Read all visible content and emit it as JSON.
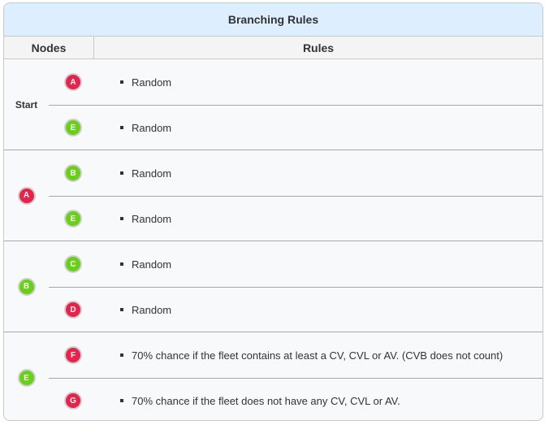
{
  "title": "Branching Rules",
  "headers": {
    "nodes": "Nodes",
    "rules": "Rules"
  },
  "colors": {
    "red_node": "#e8224a",
    "green_node": "#66d116",
    "title_bg": "#ddeeff"
  },
  "groups": [
    {
      "source": "Start",
      "source_type": "text",
      "branches": [
        {
          "node": "A",
          "color": "red",
          "rule": "Random"
        },
        {
          "node": "E",
          "color": "green",
          "rule": "Random"
        }
      ]
    },
    {
      "source": "A",
      "source_type": "node",
      "source_color": "red",
      "branches": [
        {
          "node": "B",
          "color": "green",
          "rule": "Random"
        },
        {
          "node": "E",
          "color": "green",
          "rule": "Random"
        }
      ]
    },
    {
      "source": "B",
      "source_type": "node",
      "source_color": "green",
      "branches": [
        {
          "node": "C",
          "color": "green",
          "rule": "Random"
        },
        {
          "node": "D",
          "color": "red",
          "rule": "Random"
        }
      ]
    },
    {
      "source": "E",
      "source_type": "node",
      "source_color": "green",
      "branches": [
        {
          "node": "F",
          "color": "red",
          "rule": "70% chance if the fleet contains at least a CV, CVL or AV. (CVB does not count)"
        },
        {
          "node": "G",
          "color": "red",
          "rule": "70% chance if the fleet does not have any CV, CVL or AV."
        }
      ]
    }
  ]
}
